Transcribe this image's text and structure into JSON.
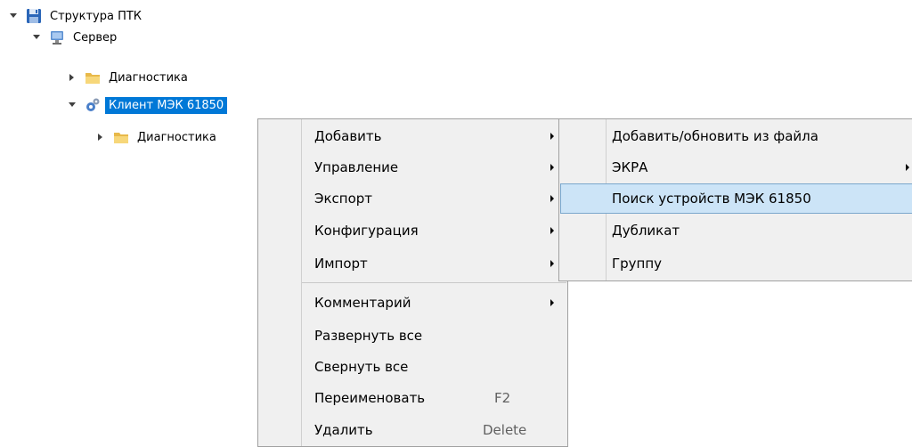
{
  "tree": {
    "root": {
      "label": "Структура ПТК",
      "icon": "floppy-disk-icon"
    },
    "server": {
      "label": "Сервер",
      "icon": "computer-icon"
    },
    "diag1": {
      "label": "Диагностика",
      "icon": "folder-icon"
    },
    "client": {
      "label": "Клиент МЭК 61850",
      "icon": "gears-icon"
    },
    "diag2": {
      "label": "Диагностика",
      "icon": "folder-icon"
    }
  },
  "context_menu": {
    "items": [
      {
        "label": "Добавить"
      },
      {
        "label": "Управление"
      },
      {
        "label": "Экспорт"
      },
      {
        "label": "Конфигурация"
      },
      {
        "label": "Импорт"
      },
      {
        "label": "Комментарий"
      },
      {
        "label": "Развернуть все"
      },
      {
        "label": "Свернуть все"
      },
      {
        "label": "Переименовать",
        "shortcut": "F2"
      },
      {
        "label": "Удалить",
        "shortcut": "Delete"
      }
    ]
  },
  "submenu": {
    "items": [
      {
        "label": "Добавить/обновить из файла"
      },
      {
        "label": "ЭКРА"
      },
      {
        "label": "Поиск устройств МЭК 61850"
      },
      {
        "label": "Дубликат"
      },
      {
        "label": "Группу"
      }
    ]
  },
  "colors": {
    "selection": "#0078d7",
    "menu_background": "#f0f0f0",
    "menu_highlight": "#cce4f7",
    "menu_highlight_border": "#7aa7cc"
  }
}
